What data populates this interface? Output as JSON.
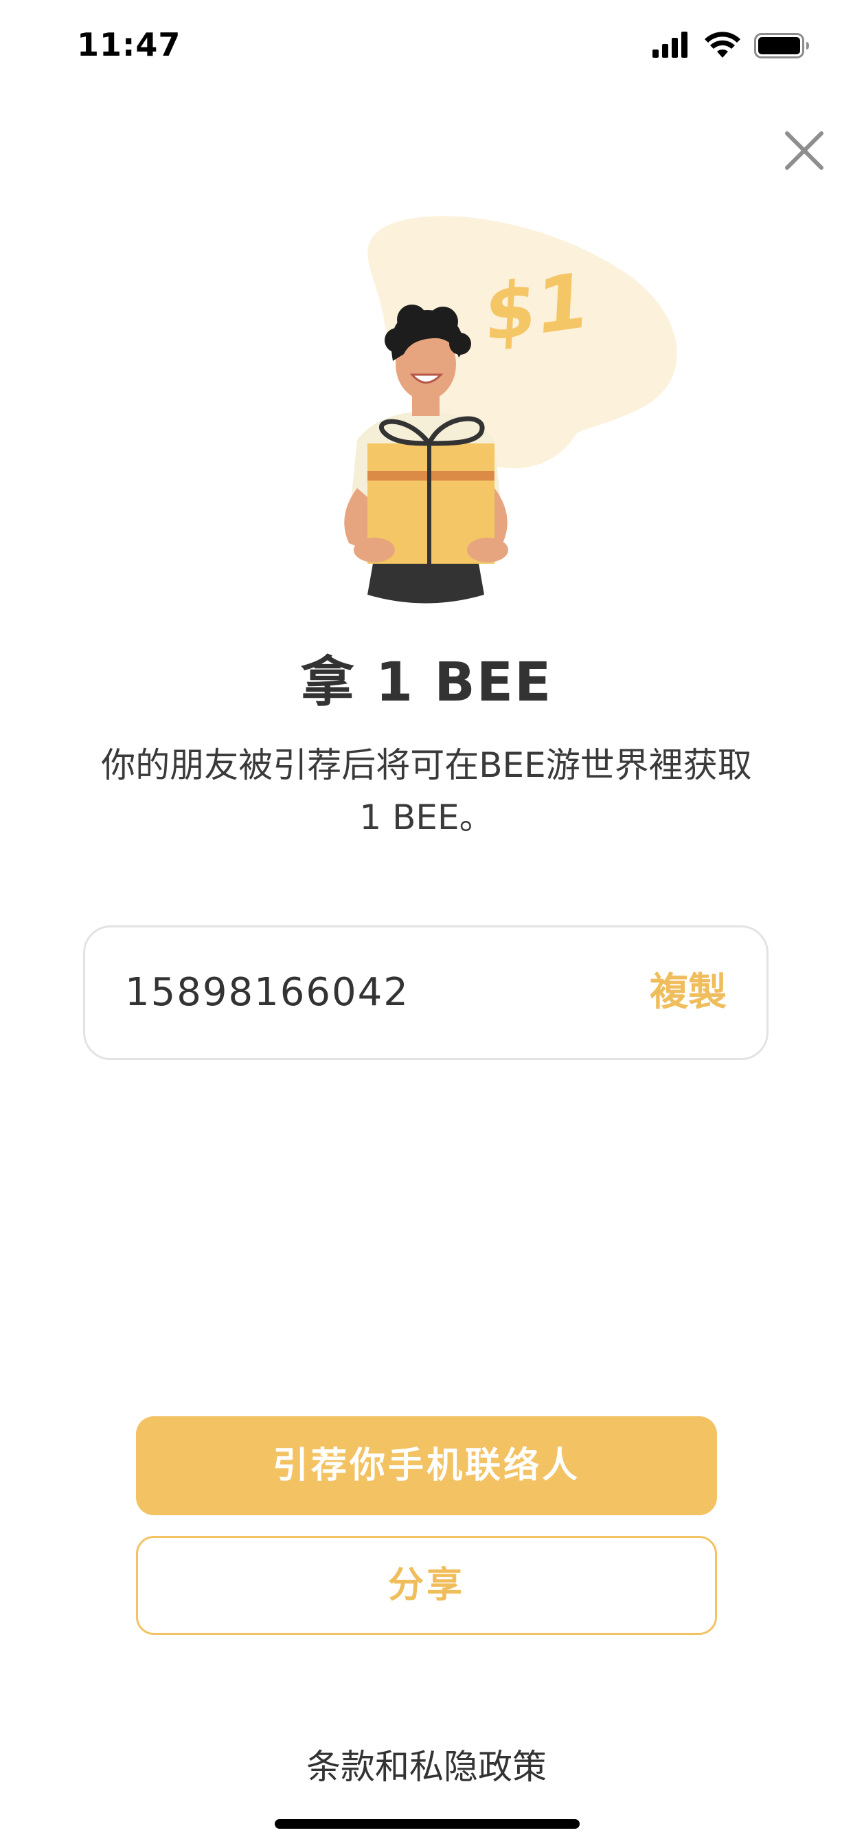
{
  "status_bar": {
    "time": "11:47"
  },
  "illustration": {
    "price_text": "$1"
  },
  "title": "拿 1 BEE",
  "description": "你的朋友被引荐后将可在BEE游世界裡获取 1 BEE。",
  "referral": {
    "code": "15898166042",
    "copy_label": "複製"
  },
  "actions": {
    "primary_label": "引荐你手机联络人",
    "secondary_label": "分享"
  },
  "footer": {
    "terms_label": "条款和私隐政策"
  },
  "colors": {
    "accent": "#f3c263",
    "accent_text": "#f0bd5c",
    "text": "#333333",
    "border": "#e3e3e3"
  },
  "icons": [
    "signal-icon",
    "wifi-icon",
    "battery-icon",
    "close-icon"
  ]
}
